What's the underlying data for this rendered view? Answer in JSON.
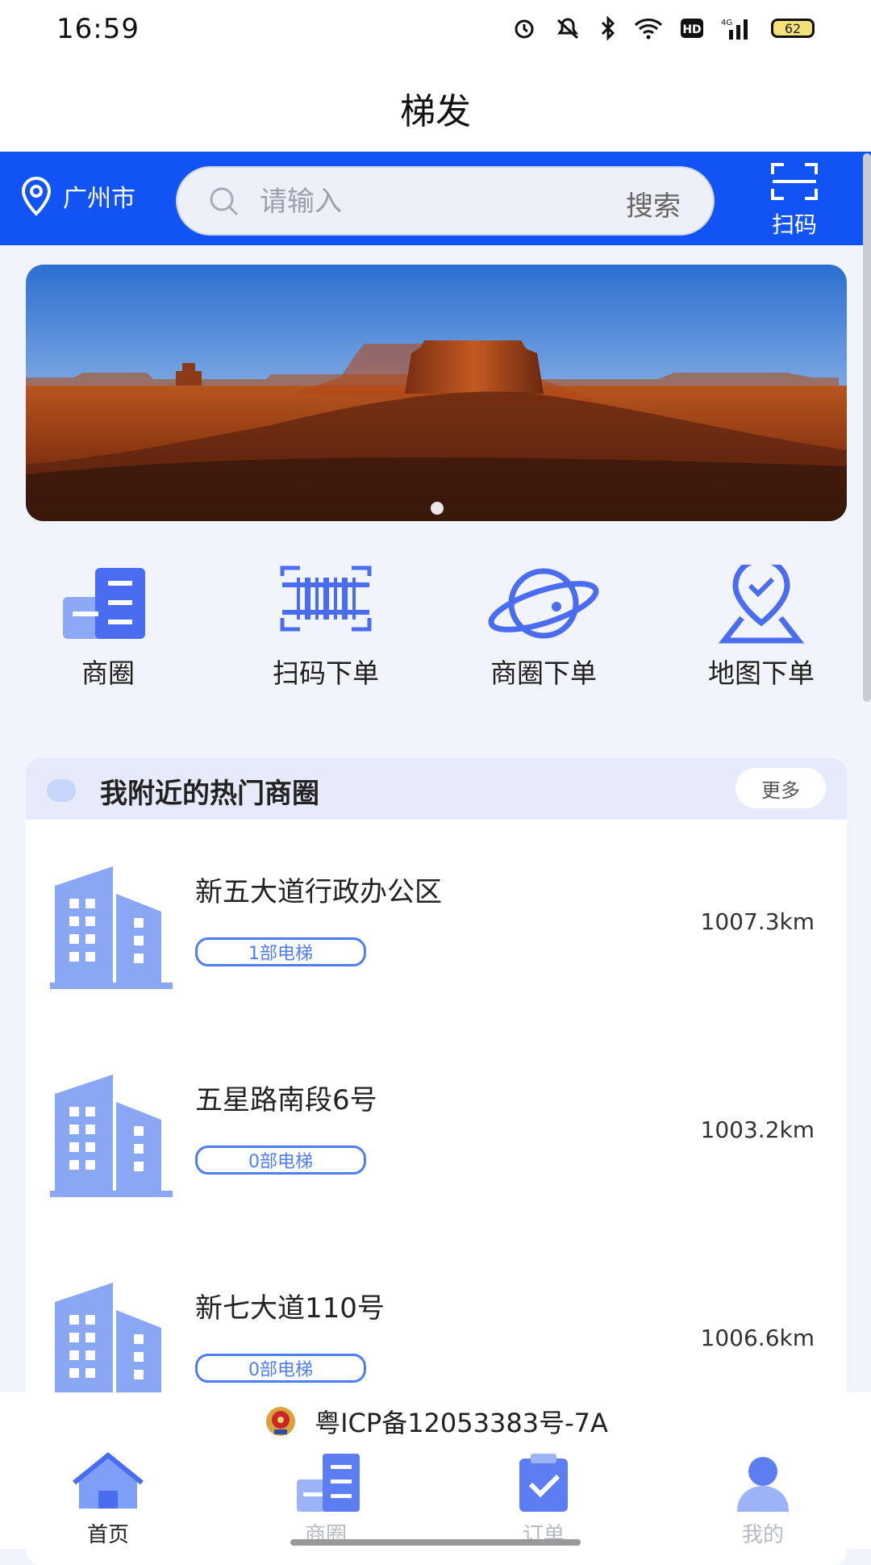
{
  "status": {
    "time": "16:59",
    "battery": "62"
  },
  "app": {
    "title": "梯发"
  },
  "header": {
    "city": "广州市",
    "search_placeholder": "请输入",
    "search_button": "搜索",
    "scan_label": "扫码"
  },
  "colors": {
    "primary": "#1253f6",
    "accent": "#4f7df5",
    "page_bg": "#f2f4fc"
  },
  "shortcuts": [
    {
      "label": "商圈",
      "icon": "business-district-icon"
    },
    {
      "label": "扫码下单",
      "icon": "barcode-icon"
    },
    {
      "label": "商圈下单",
      "icon": "planet-icon"
    },
    {
      "label": "地图下单",
      "icon": "map-pin-check-icon"
    }
  ],
  "hot": {
    "title": "我附近的热门商圈",
    "more": "更多",
    "items": [
      {
        "name": "新五大道行政办公区",
        "tag": "1部电梯",
        "distance": "1007.3km"
      },
      {
        "name": "五星路南段6号",
        "tag": "0部电梯",
        "distance": "1003.2km"
      },
      {
        "name": "新七大道110号",
        "tag": "0部电梯",
        "distance": "1006.6km"
      }
    ]
  },
  "footer": {
    "icp": "粤ICP备12053383号-7A"
  },
  "tabs": [
    {
      "label": "首页",
      "active": true
    },
    {
      "label": "商圈",
      "active": false
    },
    {
      "label": "订单",
      "active": false
    },
    {
      "label": "我的",
      "active": false
    }
  ]
}
